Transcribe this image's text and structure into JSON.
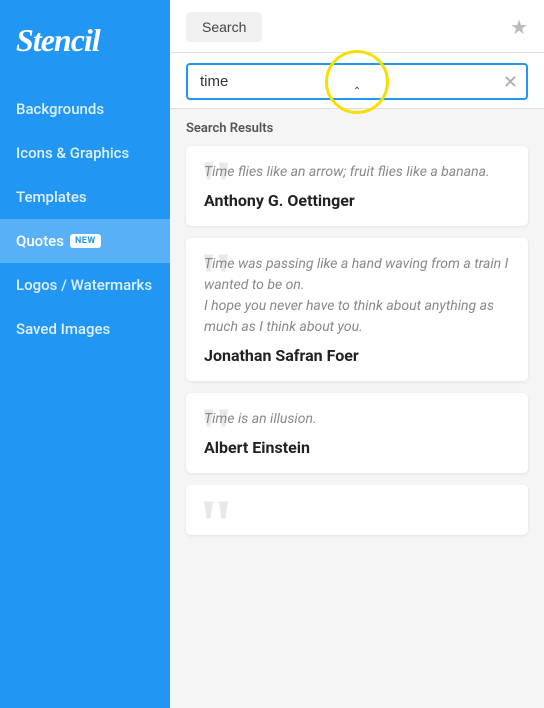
{
  "sidebar": {
    "logo": "Stencil",
    "items": [
      {
        "id": "backgrounds",
        "label": "Backgrounds",
        "active": false
      },
      {
        "id": "icons-graphics",
        "label": "Icons & Graphics",
        "active": false
      },
      {
        "id": "templates",
        "label": "Templates",
        "active": false
      },
      {
        "id": "quotes",
        "label": "Quotes",
        "active": true,
        "badge": "NEW"
      },
      {
        "id": "logos-watermarks",
        "label": "Logos / Watermarks",
        "active": false
      },
      {
        "id": "saved-images",
        "label": "Saved Images",
        "active": false
      }
    ]
  },
  "toolbar": {
    "search_label": "Search",
    "star_icon": "★"
  },
  "search": {
    "value": "time",
    "placeholder": "Search...",
    "clear_icon": "✕"
  },
  "results": {
    "label": "Search Results",
    "quotes": [
      {
        "id": "q1",
        "text": "Time flies like an arrow; fruit flies like a banana.",
        "author": "Anthony G. Oettinger"
      },
      {
        "id": "q2",
        "text": "Time was passing like a hand waving from a train I wanted to be on.\nI hope you never have to think about anything as much as I think about you.",
        "author": "Jonathan Safran Foer"
      },
      {
        "id": "q3",
        "text": "Time is an illusion.",
        "author": "Albert Einstein"
      },
      {
        "id": "q4",
        "text": "",
        "author": ""
      }
    ]
  }
}
